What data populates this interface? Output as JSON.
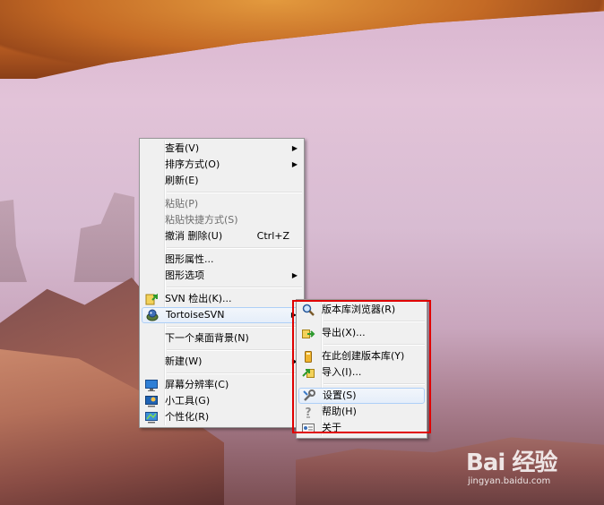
{
  "context_menu": {
    "items": [
      {
        "label": "查看(V)",
        "has_submenu": true
      },
      {
        "label": "排序方式(O)",
        "has_submenu": true
      },
      {
        "label": "刷新(E)"
      },
      {
        "label": "粘贴(P)",
        "disabled": true
      },
      {
        "label": "粘贴快捷方式(S)",
        "disabled": true
      },
      {
        "label": "撤消 删除(U)",
        "shortcut": "Ctrl+Z"
      },
      {
        "label": "图形属性..."
      },
      {
        "label": "图形选项",
        "has_submenu": true
      },
      {
        "label": "SVN 检出(K)...",
        "icon": "svn-checkout-icon"
      },
      {
        "label": "TortoiseSVN",
        "icon": "tortoisesvn-icon",
        "has_submenu": true,
        "highlighted": true
      },
      {
        "label": "下一个桌面背景(N)"
      },
      {
        "label": "新建(W)",
        "has_submenu": true
      },
      {
        "label": "屏幕分辨率(C)",
        "icon": "screen-resolution-icon"
      },
      {
        "label": "小工具(G)",
        "icon": "gadgets-icon"
      },
      {
        "label": "个性化(R)",
        "icon": "personalize-icon"
      }
    ],
    "arrow_glyph": "▶"
  },
  "tortoise_submenu": {
    "items": [
      {
        "label": "版本库浏览器(R)",
        "icon": "repo-browser-icon"
      },
      {
        "label": "导出(X)...",
        "icon": "export-icon"
      },
      {
        "label": "在此创建版本库(Y)",
        "icon": "create-repo-icon"
      },
      {
        "label": "导入(I)...",
        "icon": "import-icon"
      },
      {
        "label": "设置(S)",
        "icon": "settings-icon",
        "highlighted": true
      },
      {
        "label": "帮助(H)",
        "icon": "help-icon"
      },
      {
        "label": "关于",
        "icon": "about-icon"
      }
    ]
  },
  "watermark": {
    "logo": "Bai  经验",
    "paw": "🐾",
    "url": "jingyan.baidu.com"
  },
  "colors": {
    "highlight_border": "#e00000",
    "menu_bg": "#f0f0f0",
    "hover_bg": "#e5eefa"
  }
}
